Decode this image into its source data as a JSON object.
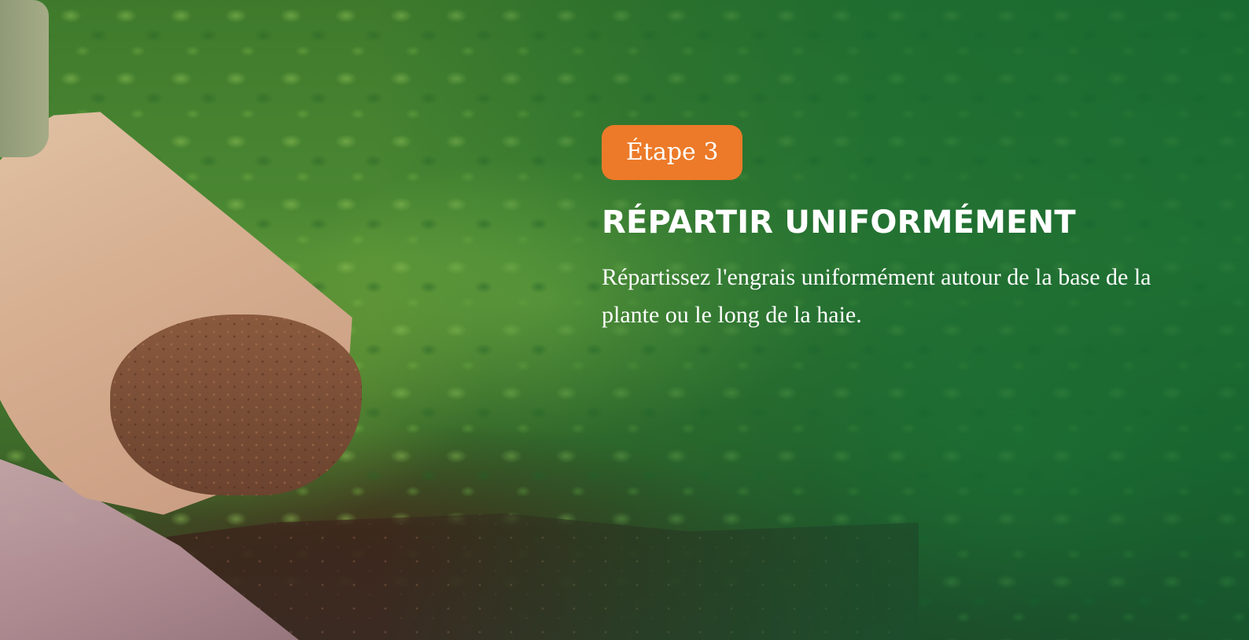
{
  "hero": {
    "step_label": "Étape 3",
    "title": "RÉPARTIR UNIFORMÉMENT",
    "description": "Répartissez l'engrais uniformément autour de la base de la plante ou le long de la haie."
  },
  "colors": {
    "badge_background": "#ec7a29",
    "text": "#ffffff",
    "overlay_green": "#0a6432"
  }
}
